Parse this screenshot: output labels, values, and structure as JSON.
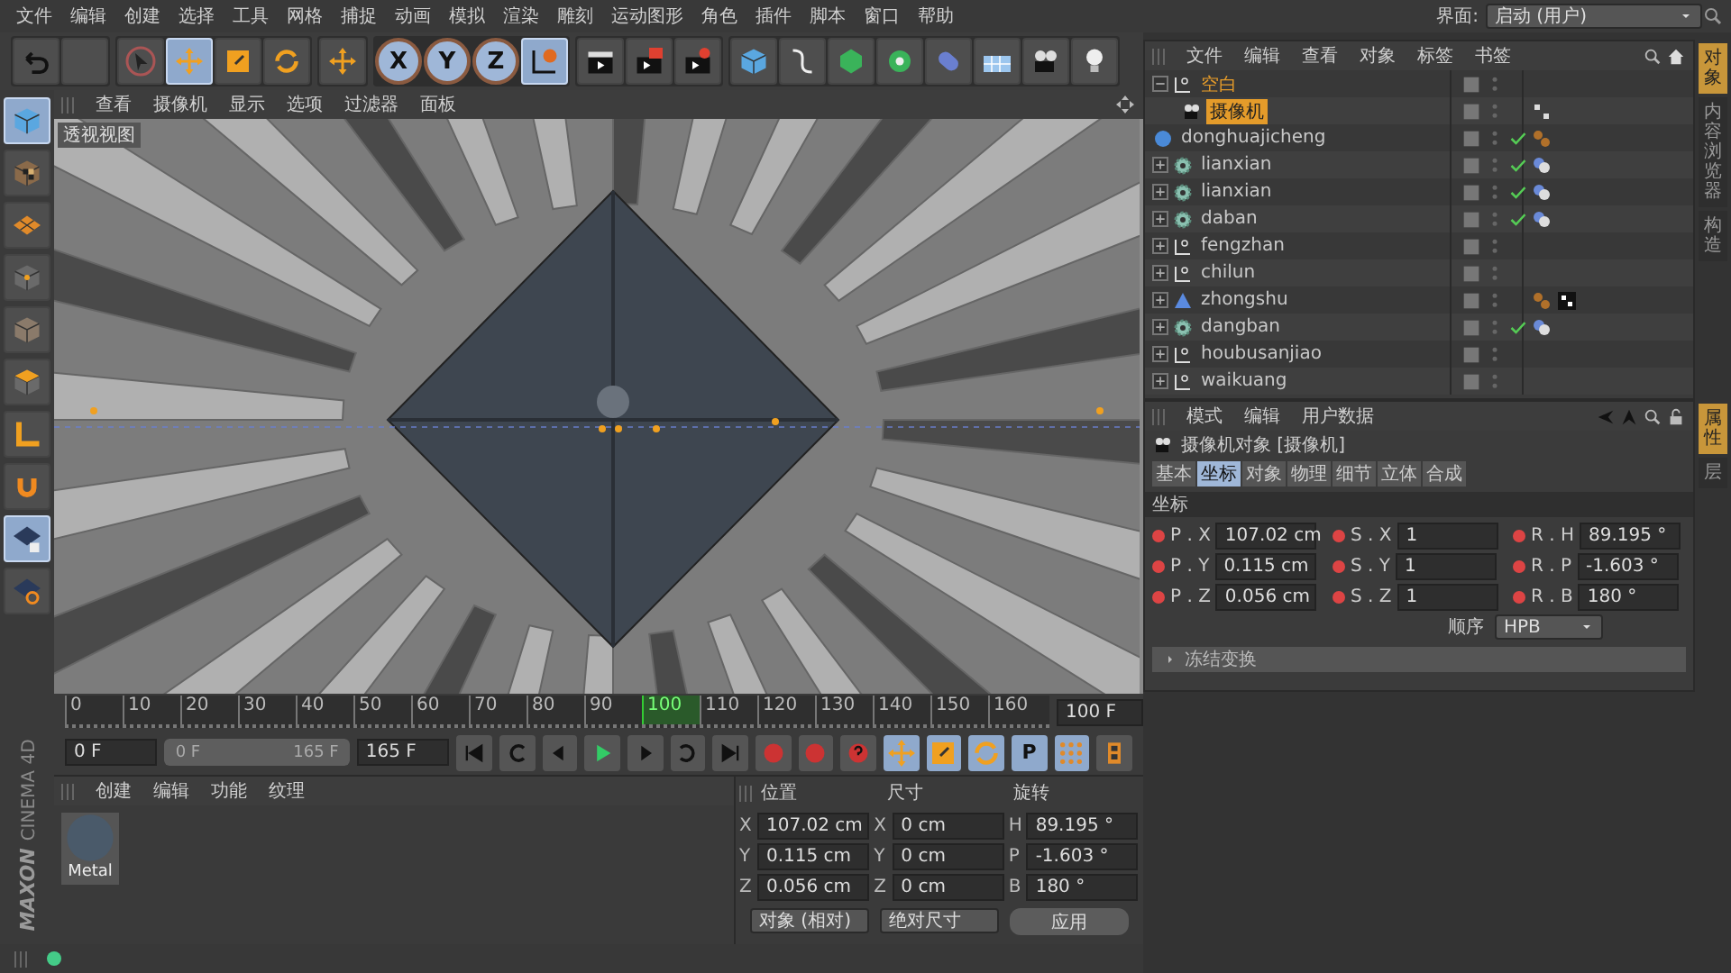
{
  "menu": [
    "文件",
    "编辑",
    "创建",
    "选择",
    "工具",
    "网格",
    "捕捉",
    "动画",
    "模拟",
    "渲染",
    "雕刻",
    "运动图形",
    "角色",
    "插件",
    "脚本",
    "窗口",
    "帮助"
  ],
  "interface": {
    "label": "界面:",
    "value": "启动 (用户)"
  },
  "toolbar": [
    {
      "kind": "undo",
      "selected": false
    },
    {
      "kind": "blank",
      "selected": false
    },
    {
      "kind": "select",
      "selected": false
    },
    {
      "kind": "move",
      "selected": true
    },
    {
      "kind": "scale",
      "selected": false
    },
    {
      "kind": "rotate",
      "selected": false
    },
    {
      "kind": "add",
      "selected": false
    },
    {
      "kind": "axis",
      "label": "X",
      "selected": true
    },
    {
      "kind": "axis",
      "label": "Y",
      "selected": true
    },
    {
      "kind": "axis",
      "label": "Z",
      "selected": true
    },
    {
      "kind": "world",
      "selected": true
    },
    {
      "kind": "render-view",
      "selected": false
    },
    {
      "kind": "render-picture",
      "selected": false
    },
    {
      "kind": "render-settings",
      "selected": false
    },
    {
      "kind": "cube",
      "selected": false
    },
    {
      "kind": "spline",
      "selected": false
    },
    {
      "kind": "gem",
      "selected": false
    },
    {
      "kind": "flower",
      "selected": false
    },
    {
      "kind": "capsule",
      "selected": false
    },
    {
      "kind": "floor",
      "selected": false
    },
    {
      "kind": "camera",
      "selected": false
    },
    {
      "kind": "light",
      "selected": false
    }
  ],
  "left_tools": [
    {
      "kind": "cube",
      "selected": true
    },
    {
      "kind": "texture-cube",
      "selected": false
    },
    {
      "kind": "grid-plane",
      "selected": false
    },
    {
      "kind": "cube-points",
      "selected": false
    },
    {
      "kind": "cube-edges",
      "selected": false
    },
    {
      "kind": "cube-face",
      "selected": false
    },
    {
      "kind": "axis-corner",
      "selected": false
    },
    {
      "kind": "magnet",
      "selected": false
    },
    {
      "kind": "grid-lock",
      "selected": true
    },
    {
      "kind": "grid-snap",
      "selected": false
    }
  ],
  "logo": {
    "brand": "MAXON",
    "product": "CINEMA 4D"
  },
  "viewport": {
    "menu": [
      "查看",
      "摄像机",
      "显示",
      "选项",
      "过滤器",
      "面板"
    ],
    "label": "透视视图"
  },
  "timeline": {
    "ticks": [
      {
        "label": "0",
        "selected": false
      },
      {
        "label": "10",
        "selected": false
      },
      {
        "label": "20",
        "selected": false
      },
      {
        "label": "30",
        "selected": false
      },
      {
        "label": "40",
        "selected": false
      },
      {
        "label": "50",
        "selected": false
      },
      {
        "label": "60",
        "selected": false
      },
      {
        "label": "70",
        "selected": false
      },
      {
        "label": "80",
        "selected": false
      },
      {
        "label": "90",
        "selected": false
      },
      {
        "label": "100",
        "selected": true
      },
      {
        "label": "110",
        "selected": false
      },
      {
        "label": "120",
        "selected": false
      },
      {
        "label": "130",
        "selected": false
      },
      {
        "label": "140",
        "selected": false
      },
      {
        "label": "150",
        "selected": false
      },
      {
        "label": "160",
        "selected": false
      }
    ],
    "current_field": "100 F",
    "start_field": "0 F",
    "range": {
      "start": "0 F",
      "end": "165 F",
      "level": 1
    },
    "end_field": "165 F",
    "key_tools": [
      {
        "kind": "move",
        "selected": true
      },
      {
        "kind": "scale",
        "selected": true
      },
      {
        "kind": "rotate",
        "selected": true
      },
      {
        "kind": "param",
        "label": "P",
        "selected": true
      },
      {
        "kind": "dots",
        "selected": true
      }
    ]
  },
  "materials": {
    "menu": [
      "创建",
      "编辑",
      "功能",
      "纹理"
    ],
    "items": [
      {
        "name": "Metal"
      }
    ]
  },
  "coordinates": {
    "headers": [
      "位置",
      "尺寸",
      "旋转"
    ],
    "rows": [
      [
        {
          "axis": "X",
          "value": "107.02 cm"
        },
        {
          "axis": "X",
          "value": "0 cm"
        },
        {
          "axis": "H",
          "value": "89.195 °"
        }
      ],
      [
        {
          "axis": "Y",
          "value": "0.115 cm"
        },
        {
          "axis": "Y",
          "value": "0 cm"
        },
        {
          "axis": "P",
          "value": "-1.603 °"
        }
      ],
      [
        {
          "axis": "Z",
          "value": "0.056 cm"
        },
        {
          "axis": "Z",
          "value": "0 cm"
        },
        {
          "axis": "B",
          "value": "180 °"
        }
      ]
    ],
    "mode": "对象 (相对)",
    "size_mode": "绝对尺寸",
    "apply": "应用"
  },
  "objects": {
    "menu": [
      "文件",
      "编辑",
      "查看",
      "对象",
      "标签",
      "书签"
    ],
    "items": [
      {
        "name": "空白",
        "kind": "null",
        "expanded": true,
        "selected": false,
        "checked": false,
        "children": [
          {
            "name": "摄像机",
            "kind": "camera",
            "selected": true,
            "checked": false,
            "tags": [
              {
                "kind": "target"
              }
            ]
          }
        ]
      },
      {
        "name": "donghuajicheng",
        "kind": "sphere",
        "selected": false,
        "checked": true,
        "tags": [
          {
            "kind": "material"
          }
        ]
      },
      {
        "name": "lianxian",
        "kind": "gear",
        "expanded": false,
        "selected": false,
        "checked": true,
        "tags": [
          {
            "kind": "blob"
          }
        ]
      },
      {
        "name": "lianxian",
        "kind": "gear",
        "expanded": false,
        "selected": false,
        "checked": true,
        "tags": [
          {
            "kind": "blob"
          }
        ]
      },
      {
        "name": "daban",
        "kind": "gear",
        "expanded": false,
        "selected": false,
        "checked": true,
        "tags": [
          {
            "kind": "blob"
          }
        ]
      },
      {
        "name": "fengzhan",
        "kind": "null",
        "expanded": false,
        "selected": false,
        "checked": false
      },
      {
        "name": "chilun",
        "kind": "null",
        "expanded": false,
        "selected": false,
        "checked": false
      },
      {
        "name": "zhongshu",
        "kind": "symmetry",
        "expanded": false,
        "selected": false,
        "checked": false,
        "tags": [
          {
            "kind": "material"
          },
          {
            "kind": "checker"
          }
        ]
      },
      {
        "name": "dangban",
        "kind": "gear",
        "expanded": false,
        "selected": false,
        "checked": true,
        "tags": [
          {
            "kind": "blob"
          }
        ]
      },
      {
        "name": "houbusanjiao",
        "kind": "null",
        "expanded": false,
        "selected": false,
        "checked": false
      },
      {
        "name": "waikuang",
        "kind": "null",
        "expanded": false,
        "selected": false,
        "checked": false
      }
    ]
  },
  "side_tabs_top": [
    {
      "label": "对象",
      "selected": true
    },
    {
      "label": "内容浏览器",
      "selected": false
    },
    {
      "label": "构造",
      "selected": false
    }
  ],
  "attributes": {
    "menu": [
      "模式",
      "编辑",
      "用户数据"
    ],
    "title": "摄像机对象 [摄像机]",
    "tabs": [
      {
        "label": "基本",
        "selected": false
      },
      {
        "label": "坐标",
        "selected": true
      },
      {
        "label": "对象",
        "selected": false
      },
      {
        "label": "物理",
        "selected": false
      },
      {
        "label": "细节",
        "selected": false
      },
      {
        "label": "立体",
        "selected": false
      },
      {
        "label": "合成",
        "selected": false
      }
    ],
    "section": "坐标",
    "rows": [
      [
        {
          "label": "P . X",
          "value": "107.02 cm"
        },
        {
          "label": "S . X",
          "value": "1"
        },
        {
          "label": "R . H",
          "value": "89.195 °"
        }
      ],
      [
        {
          "label": "P . Y",
          "value": "0.115 cm"
        },
        {
          "label": "S . Y",
          "value": "1"
        },
        {
          "label": "R . P",
          "value": "-1.603 °"
        }
      ],
      [
        {
          "label": "P . Z",
          "value": "0.056 cm"
        },
        {
          "label": "S . Z",
          "value": "1"
        },
        {
          "label": "R . B",
          "value": "180 °"
        }
      ]
    ],
    "order": {
      "label": "顺序",
      "value": "HPB"
    },
    "group": {
      "label": "冻结变换",
      "expanded": false
    }
  },
  "side_tabs_bottom": [
    {
      "label": "属性",
      "selected": true
    },
    {
      "label": "层",
      "selected": false
    }
  ]
}
